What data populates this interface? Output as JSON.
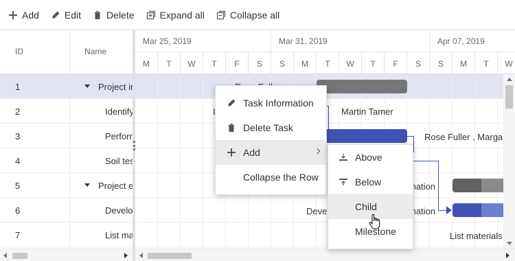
{
  "toolbar": {
    "items": [
      {
        "label": "Add",
        "icon": "plus-icon"
      },
      {
        "label": "Edit",
        "icon": "pencil-icon"
      },
      {
        "label": "Delete",
        "icon": "trash-icon"
      },
      {
        "label": "Expand all",
        "icon": "expand-all-icon"
      },
      {
        "label": "Collapse all",
        "icon": "collapse-all-icon"
      }
    ]
  },
  "grid": {
    "columns": {
      "id": "ID",
      "name": "Name"
    },
    "rows": [
      {
        "id": "1",
        "name": "Project in",
        "parent": true,
        "selected": true
      },
      {
        "id": "2",
        "name": "Identify",
        "parent": false
      },
      {
        "id": "3",
        "name": "Perforr",
        "parent": false
      },
      {
        "id": "4",
        "name": "Soil tes",
        "parent": false
      },
      {
        "id": "5",
        "name": "Project e",
        "parent": true
      },
      {
        "id": "6",
        "name": "Develo",
        "parent": false
      },
      {
        "id": "7",
        "name": "List ma",
        "parent": false
      }
    ]
  },
  "timeline": {
    "weeks": [
      "Mar 25, 2019",
      "Mar 31, 2019",
      "Apr 07, 2019"
    ],
    "days": [
      "M",
      "T",
      "W",
      "T",
      "F",
      "S",
      "S",
      "M",
      "T",
      "W",
      "T",
      "F",
      "S",
      "S",
      "M",
      "T",
      "W"
    ]
  },
  "gantt_labels": {
    "row1_partial": "Rose Fuller",
    "row2_partial": "I",
    "row2_resource": "Martin Tamer",
    "row3_resource": "Rose Fuller , Margar",
    "row5_partial": "mation",
    "row6_partial_left": "Devel",
    "row6_partial_right": "mation",
    "row7_partial": "List materials"
  },
  "colors": {
    "accent": "#3f51b5",
    "accent_light": "#5c6bc0",
    "parent_bar": "#757575",
    "selected_row": "#e2e4f4"
  },
  "context_menu": {
    "items": [
      {
        "label": "Task Information",
        "icon": "pencil-icon"
      },
      {
        "label": "Delete Task",
        "icon": "trash-icon"
      },
      {
        "label": "Add",
        "icon": "plus-icon",
        "submenu": true
      },
      {
        "label": "Collapse the Row",
        "icon": ""
      }
    ],
    "submenu": [
      {
        "label": "Above",
        "icon": "insert-above-icon"
      },
      {
        "label": "Below",
        "icon": "insert-below-icon"
      },
      {
        "label": "Child",
        "icon": ""
      },
      {
        "label": "Milestone",
        "icon": ""
      }
    ]
  }
}
